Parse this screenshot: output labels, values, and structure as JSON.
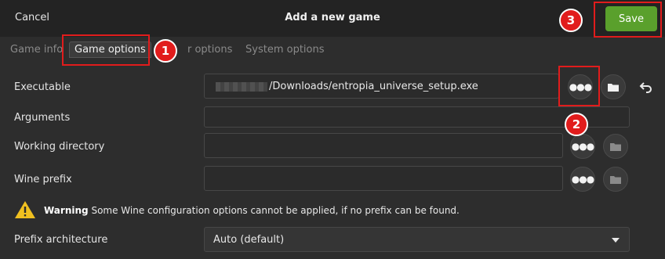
{
  "header": {
    "cancel_label": "Cancel",
    "title": "Add a new game",
    "save_label": "Save"
  },
  "tabs": [
    {
      "label": "Game info",
      "active": false
    },
    {
      "label": "Game options",
      "active": true
    },
    {
      "label": "Runner options",
      "visible_text": "r options",
      "active": false
    },
    {
      "label": "System options",
      "active": false
    }
  ],
  "form": {
    "executable": {
      "label": "Executable",
      "value": "/Downloads/entropia_universe_setup.exe"
    },
    "arguments": {
      "label": "Arguments",
      "value": ""
    },
    "working_directory": {
      "label": "Working directory",
      "value": ""
    },
    "wine_prefix": {
      "label": "Wine prefix",
      "value": ""
    },
    "warning": {
      "title": "Warning",
      "text": "Some Wine configuration options cannot be applied, if no prefix can be found."
    },
    "prefix_architecture": {
      "label": "Prefix architecture",
      "value": "Auto (default)"
    }
  },
  "annotations": {
    "step1": "1",
    "step2": "2",
    "step3": "3"
  },
  "icons": [
    "more-options-icon",
    "folder-icon",
    "undo-icon",
    "warning-icon",
    "dropdown-caret-icon"
  ],
  "colors": {
    "accent_save": "#5aa02c",
    "annotation_red": "#e11c1c",
    "warning_yellow": "#f0c020",
    "background": "#2d2d2d",
    "headerbar": "#232323"
  }
}
